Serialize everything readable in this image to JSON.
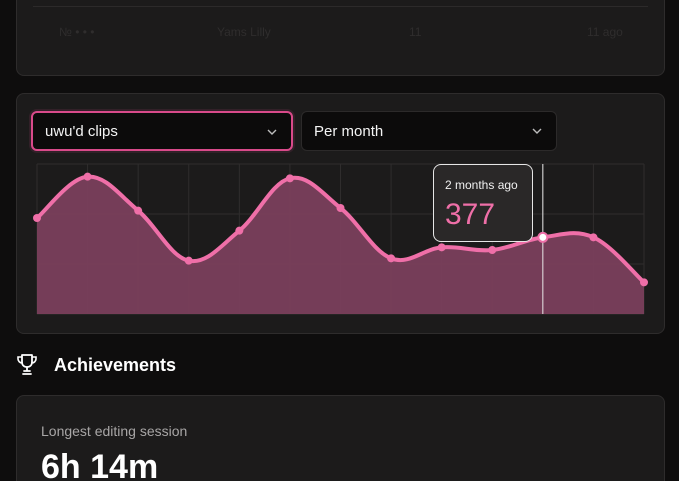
{
  "top_table": {
    "cells": [
      "№ • • •",
      "Yams Lilly",
      "11",
      "11 ago"
    ]
  },
  "filters": {
    "clip_select": "uwu'd clips",
    "period_select": "Per month"
  },
  "chart_data": {
    "type": "area",
    "title": "",
    "xlabel": "",
    "ylabel": "",
    "ylim": [
      0,
      450
    ],
    "grid": true,
    "colors": {
      "line": "#ef6fa8",
      "fill": "#7a3f5c"
    },
    "x_index": [
      0,
      1,
      2,
      3,
      4,
      5,
      6,
      7,
      8,
      9,
      10,
      11,
      12
    ],
    "values": [
      288,
      412,
      310,
      160,
      250,
      407,
      318,
      167,
      200,
      192,
      230,
      230,
      95
    ],
    "highlight": {
      "index": 10,
      "label": "2 months ago",
      "value": 377
    }
  },
  "achievements": {
    "title": "Achievements",
    "icon": "trophy-icon",
    "longest_session_label": "Longest editing session",
    "longest_session_value": "6h 14m"
  }
}
